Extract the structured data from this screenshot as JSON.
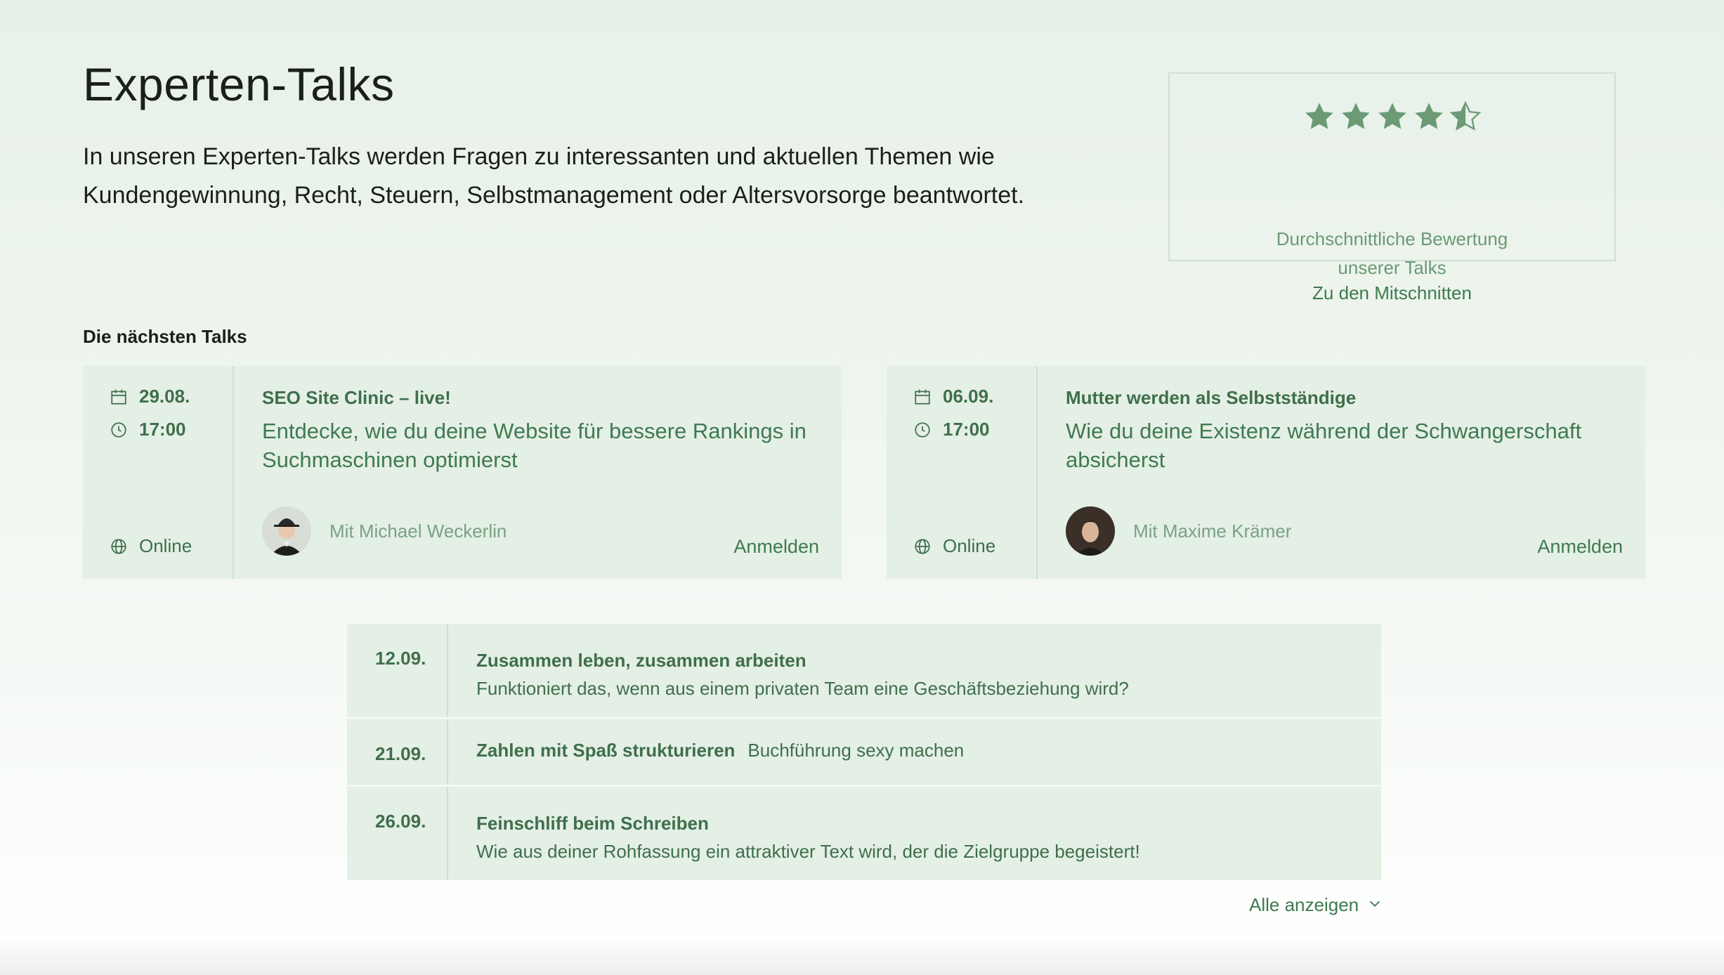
{
  "header": {
    "title": "Experten-Talks",
    "intro": "In unseren Experten-Talks werden Fragen zu interessanten und aktuellen Themen wie Kundengewinnung, Recht, Steuern, Selbstmanagement oder Altersvorsorge beantwortet."
  },
  "rating": {
    "stars": 4.5,
    "max_stars": 5,
    "label_line1": "Durchschnittliche Bewertung",
    "label_line2": "unserer Talks",
    "link": "Zu den Mitschnitten",
    "star_color": "#6b9a75"
  },
  "upcoming": {
    "heading": "Die nächsten Talks",
    "cards": [
      {
        "date": "29.08.",
        "time": "17:00",
        "place": "Online",
        "title": "SEO Site Clinic – live!",
        "subtitle": "Entdecke, wie du deine Website für bessere Rankings in Suchmaschinen optimierst",
        "speaker": "Mit Michael Weckerlin",
        "action": "Anmelden"
      },
      {
        "date": "06.09.",
        "time": "17:00",
        "place": "Online",
        "title": "Mutter werden als Selbstständige",
        "subtitle": "Wie du deine Existenz während der Schwangerschaft absicherst",
        "speaker": "Mit Maxime Krämer",
        "action": "Anmelden"
      }
    ]
  },
  "list": {
    "rows": [
      {
        "date": "12.09.",
        "title": "Zusammen leben, zusammen arbeiten",
        "description": "Funktioniert das, wenn aus einem privaten Team eine Geschäftsbeziehung wird?"
      },
      {
        "date": "21.09.",
        "title": "Zahlen mit Spaß strukturieren",
        "description": "Buchführung sexy machen"
      },
      {
        "date": "26.09.",
        "title": "Feinschliff beim Schreiben",
        "description": "Wie aus deiner Rohfassung ein attraktiver Text wird, der die Zielgruppe begeistert!"
      }
    ],
    "show_all": "Alle anzeigen"
  },
  "colors": {
    "accent": "#3f7a50",
    "card_bg": "#e4efe5",
    "muted": "#7aa283"
  },
  "icons": {
    "date": "calendar-icon",
    "time": "clock-icon",
    "place": "globe-icon",
    "expand": "chevron-down-icon",
    "rating": "star-icon"
  }
}
